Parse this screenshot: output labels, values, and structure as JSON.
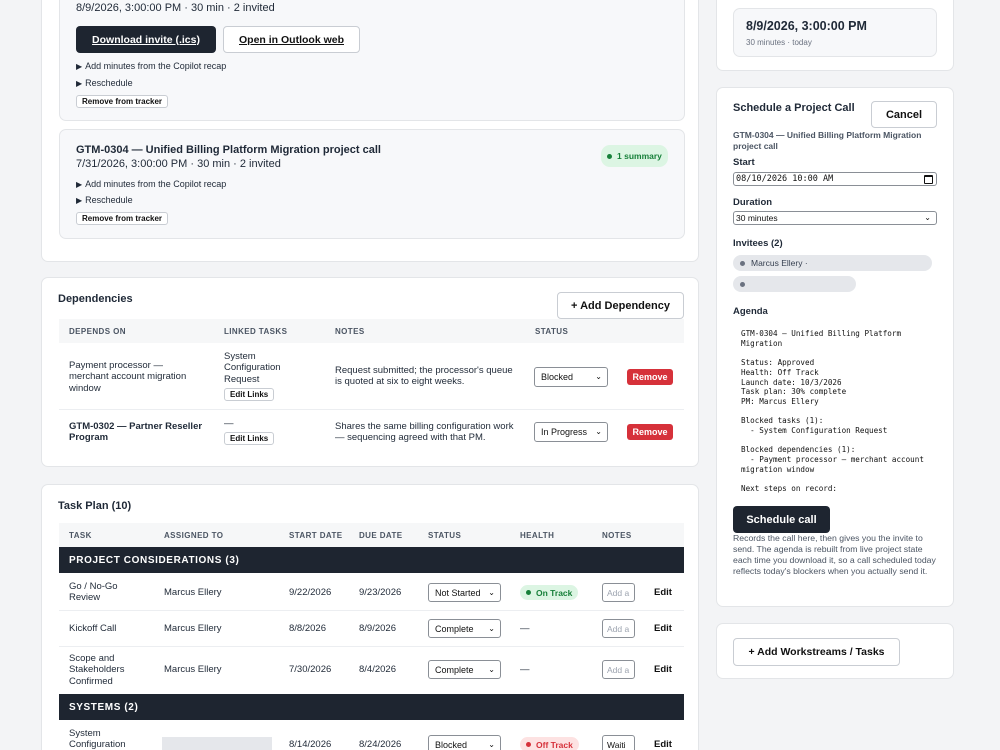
{
  "meetings": {
    "first": {
      "meta": "8/9/2026, 3:00:00 PM · 30 min · 2 invited",
      "download_label": "Download invite (.ics)",
      "outlook_label": "Open in Outlook web",
      "add_minutes": "Add minutes from the Copilot recap",
      "reschedule": "Reschedule",
      "remove": "Remove from tracker"
    },
    "second": {
      "title": "GTM-0304 — Unified Billing Platform Migration project call",
      "meta": "7/31/2026, 3:00:00 PM · 30 min · 2 invited",
      "badge": "1 summary",
      "add_minutes": "Add minutes from the Copilot recap",
      "reschedule": "Reschedule",
      "remove": "Remove from tracker"
    }
  },
  "dependencies": {
    "title": "Dependencies",
    "add_label": "+ Add Dependency",
    "headers": [
      "DEPENDS ON",
      "LINKED TASKS",
      "NOTES",
      "STATUS"
    ],
    "rows": [
      {
        "depends_on": "Payment processor — merchant account migration window",
        "linked": "System Configuration Request",
        "edit_links": "Edit Links",
        "notes": "Request submitted; the processor's queue is quoted at six to eight weeks.",
        "status": "Blocked",
        "remove": "Remove"
      },
      {
        "depends_on": "GTM-0302 — Partner Reseller Program",
        "linked": "—",
        "edit_links": "Edit Links",
        "notes": "Shares the same billing configuration work — sequencing agreed with that PM.",
        "status": "In Progress",
        "remove": "Remove"
      }
    ]
  },
  "task_plan": {
    "title": "Task Plan (10)",
    "headers": [
      "TASK",
      "ASSIGNED TO",
      "START DATE",
      "DUE DATE",
      "STATUS",
      "HEALTH",
      "NOTES"
    ],
    "groups": [
      {
        "name": "PROJECT CONSIDERATIONS (3)",
        "rows": [
          {
            "task": "Go / No-Go Review",
            "assigned": "Marcus Ellery",
            "start": "9/22/2026",
            "due": "9/23/2026",
            "status": "Not Started",
            "health": "On Track",
            "notes_placeholder": "Add a",
            "edit": "Edit"
          },
          {
            "task": "Kickoff Call",
            "assigned": "Marcus Ellery",
            "start": "8/8/2026",
            "due": "8/9/2026",
            "status": "Complete",
            "health": "—",
            "notes_placeholder": "Add a",
            "edit": "Edit"
          },
          {
            "task": "Scope and Stakeholders Confirmed",
            "assigned": "Marcus Ellery",
            "start": "7/30/2026",
            "due": "8/4/2026",
            "status": "Complete",
            "health": "—",
            "notes_placeholder": "Add a",
            "edit": "Edit"
          }
        ]
      },
      {
        "name": "SYSTEMS (2)",
        "rows": [
          {
            "task": "System Configuration",
            "assigned": "",
            "start": "8/14/2026",
            "due": "8/24/2026",
            "status": "Blocked",
            "health": "Off Track",
            "notes_value": "Waiti",
            "edit": "Edit"
          }
        ]
      }
    ]
  },
  "next_call": {
    "datetime": "8/9/2026, 3:00:00 PM",
    "sub": "30 minutes · today"
  },
  "schedule": {
    "title": "Schedule a Project Call",
    "cancel": "Cancel",
    "project": "GTM-0304 — Unified Billing Platform Migration project call",
    "start_label": "Start",
    "start_value": "08/10/2026 10:00 AM",
    "duration_label": "Duration",
    "duration_value": "30 minutes",
    "invitees_label": "Invitees (2)",
    "invitees": [
      "Marcus Ellery ·",
      ""
    ],
    "agenda_label": "Agenda",
    "agenda_text": "GTM-0304 — Unified Billing Platform\nMigration\n\nStatus: Approved\nHealth: Off Track\nLaunch date: 10/3/2026\nTask plan: 30% complete\nPM: Marcus Ellery\n\nBlocked tasks (1):\n  - System Configuration Request\n\nBlocked dependencies (1):\n  - Payment processor — merchant account\nmigration window\n\nNext steps on record:",
    "submit": "Schedule call",
    "help": "Records the call here, then gives you the invite to send. The agenda is rebuilt from live project state each time you download it, so a call scheduled today reflects today's blockers when you actually send it."
  },
  "workstreams": {
    "add_label": "+ Add Workstreams / Tasks"
  },
  "colors": {
    "dark": "#1e2530",
    "danger": "#d6313a",
    "success_bg": "#dcf5e3",
    "success_fg": "#17803a",
    "offtrack_bg": "#fde2e2",
    "offtrack_fg": "#d6313a"
  },
  "icons": {
    "disclosure": "triangle-right-icon",
    "calendar": "calendar-icon",
    "dropdown": "chevron-down-icon"
  }
}
